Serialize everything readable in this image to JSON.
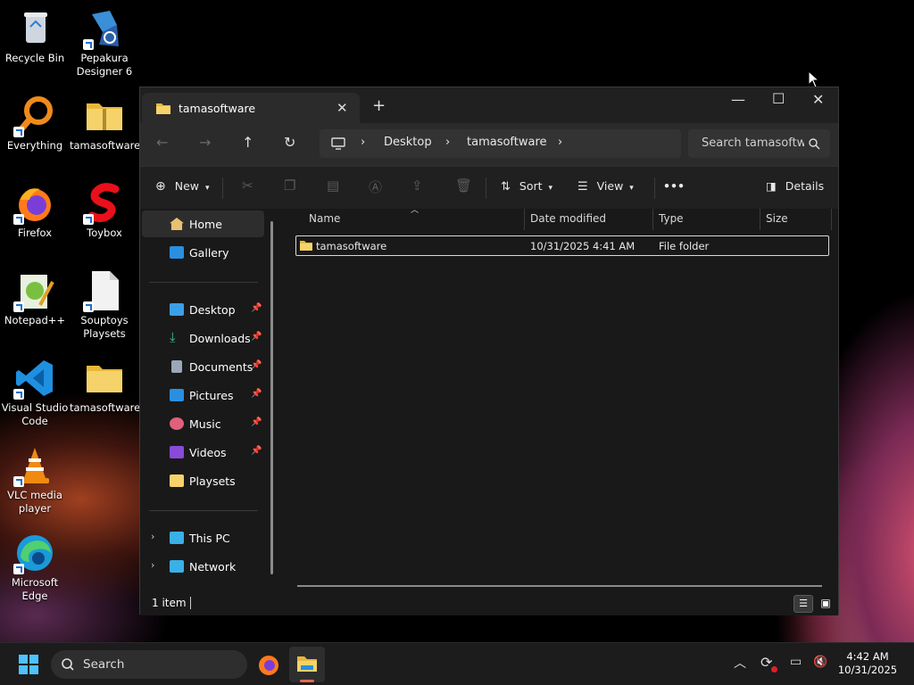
{
  "desktop": {
    "icons": [
      {
        "label": "Recycle Bin"
      },
      {
        "label": "Pepakura Designer 6"
      },
      {
        "label": "Everything"
      },
      {
        "label": "tamasoftware"
      },
      {
        "label": "Firefox"
      },
      {
        "label": "Toybox"
      },
      {
        "label": "Notepad++"
      },
      {
        "label": "Souptoys Playsets"
      },
      {
        "label": "Visual Studio Code"
      },
      {
        "label": "tamasoftware"
      },
      {
        "label": "VLC media player"
      },
      {
        "label": "Microsoft Edge"
      }
    ]
  },
  "explorer": {
    "tab_title": "tamasoftware",
    "breadcrumb": [
      "Desktop",
      "tamasoftware"
    ],
    "search_placeholder": "Search tamasoftware",
    "toolbar": {
      "new": "New",
      "sort": "Sort",
      "view": "View",
      "more": "•••",
      "details": "Details"
    },
    "sidebar": {
      "top": [
        {
          "label": "Home"
        },
        {
          "label": "Gallery"
        }
      ],
      "quick": [
        {
          "label": "Desktop"
        },
        {
          "label": "Downloads"
        },
        {
          "label": "Documents"
        },
        {
          "label": "Pictures"
        },
        {
          "label": "Music"
        },
        {
          "label": "Videos"
        },
        {
          "label": "Playsets"
        }
      ],
      "bottom": [
        {
          "label": "This PC"
        },
        {
          "label": "Network"
        }
      ]
    },
    "columns": [
      "Name",
      "Date modified",
      "Type",
      "Size"
    ],
    "rows": [
      {
        "name": "tamasoftware",
        "date": "10/31/2025 4:41 AM",
        "type": "File folder",
        "size": ""
      }
    ],
    "status": "1 item"
  },
  "taskbar": {
    "search_placeholder": "Search",
    "time": "4:42 AM",
    "date": "10/31/2025"
  },
  "colors": {
    "folder": "#f4c542",
    "accent": "#4cc2ff",
    "selection_border": "#d9d9d9"
  }
}
